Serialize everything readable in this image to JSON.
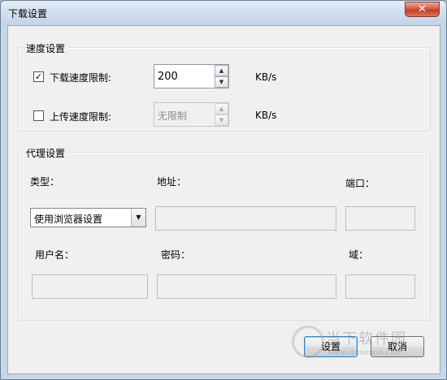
{
  "window": {
    "title": "下载设置",
    "close_label": "✕"
  },
  "speed_group": {
    "title": "速度设置",
    "download": {
      "checked": true,
      "label": "下载速度限制:",
      "value": "200",
      "unit": "KB/s"
    },
    "upload": {
      "checked": false,
      "label": "上传速度限制:",
      "value": "无限制",
      "unit": "KB/s"
    }
  },
  "proxy_group": {
    "title": "代理设置",
    "type_label": "类型：",
    "address_label": "地址：",
    "port_label": "端口：",
    "type_value": "使用浏览器设置",
    "username_label": "用户名：",
    "password_label": "密码：",
    "domain_label": "域："
  },
  "buttons": {
    "ok": "设置",
    "cancel": "取消"
  },
  "watermark": {
    "title": "当下软件园",
    "url": "www.downxia.com"
  }
}
